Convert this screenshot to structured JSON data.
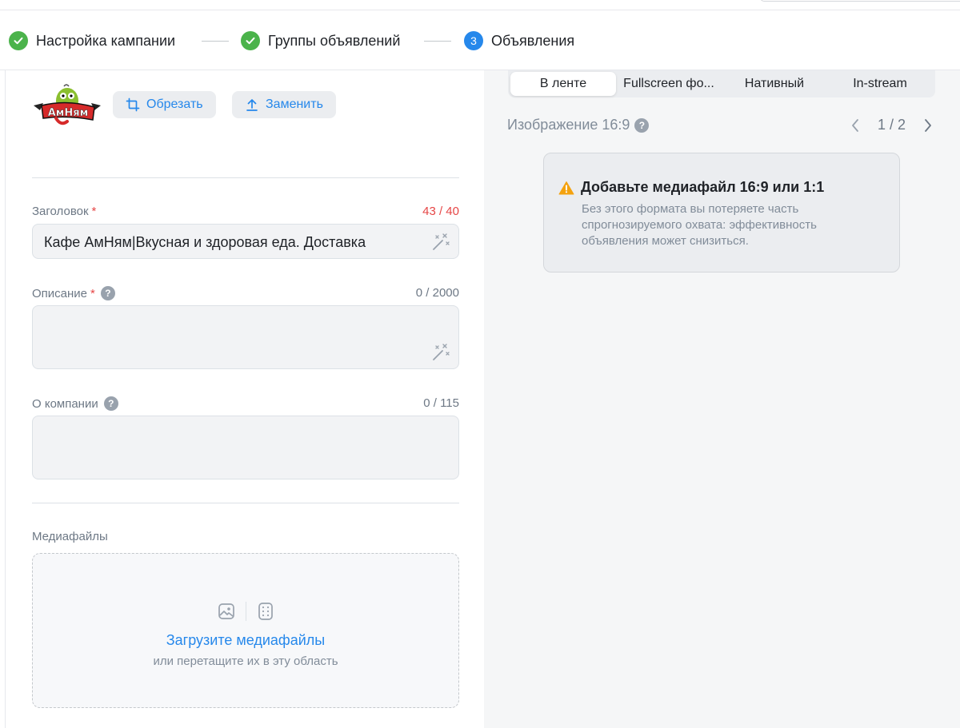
{
  "stepper": {
    "steps": [
      {
        "label": "Настройка кампании",
        "state": "done"
      },
      {
        "label": "Группы объявлений",
        "state": "done"
      },
      {
        "label": "Объявления",
        "state": "current",
        "number": "3"
      }
    ]
  },
  "logo": {
    "text": "АмНям"
  },
  "image_actions": {
    "crop_label": "Обрезать",
    "replace_label": "Заменить"
  },
  "headline": {
    "label": "Заголовок",
    "required_mark": "*",
    "counter": "43 / 40",
    "value": "Кафе АмНям|Вкусная и здоровая еда. Доставка"
  },
  "description": {
    "label": "Описание",
    "required_mark": "*",
    "counter": "0 / 2000",
    "value": ""
  },
  "about": {
    "label": "О компании",
    "counter": "0 / 115",
    "value": ""
  },
  "media": {
    "label": "Медиафайлы",
    "upload_title": "Загрузите медиафайлы",
    "upload_hint": "или перетащите их в эту область"
  },
  "preview": {
    "tabs": [
      "В ленте",
      "Fullscreen фо...",
      "Нативный",
      "In-stream"
    ],
    "active_tab": 0,
    "format_title": "Изображение 16:9",
    "page": "1 / 2",
    "warning": {
      "title": "Добавьте медиафайл 16:9 или 1:1",
      "text": "Без этого формата вы потеряете часть спрогнозируемого охвата: эффективность объявления может снизиться."
    }
  },
  "colors": {
    "accent": "#2688eb",
    "success": "#4bb34b",
    "error": "#e64646",
    "warning": "#f4a20f"
  }
}
